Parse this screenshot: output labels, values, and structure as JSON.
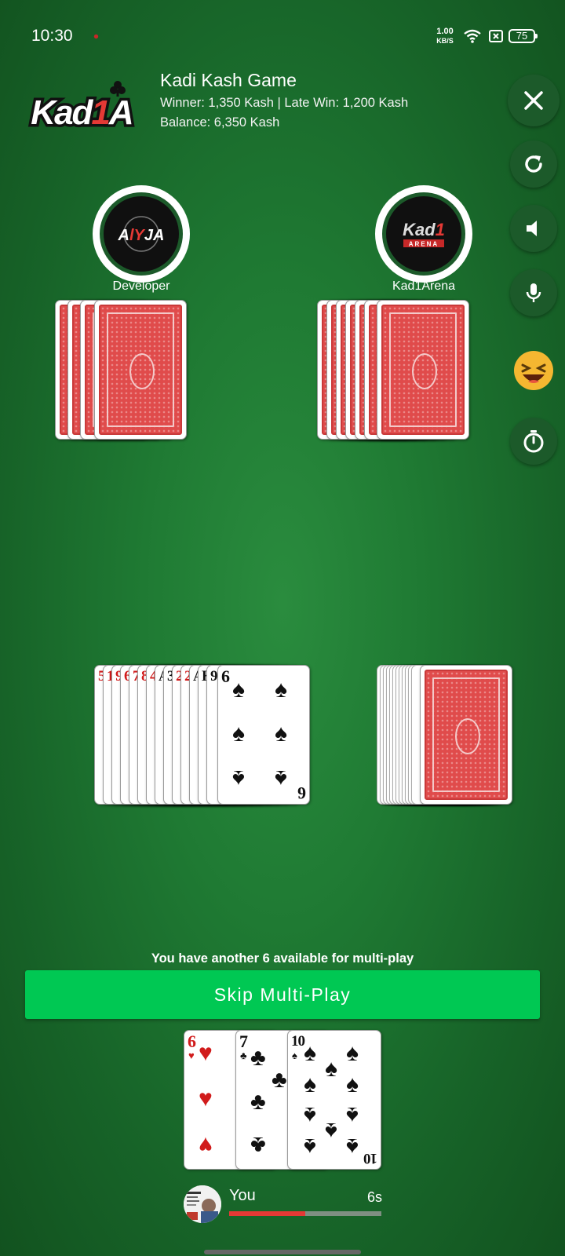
{
  "status_bar": {
    "time": "10:30",
    "net_speed_value": "1.00",
    "net_speed_unit": "KB/S",
    "battery": "75"
  },
  "header": {
    "logo_text": "Kad1A",
    "title": "Kadi Kash Game",
    "prize_line": "Winner: 1,350 Kash | Late Win: 1,200 Kash",
    "balance_line": "Balance: 6,350 Kash"
  },
  "side_buttons": [
    {
      "name": "close-icon"
    },
    {
      "name": "refresh-icon"
    },
    {
      "name": "speaker-icon"
    },
    {
      "name": "microphone-icon"
    },
    {
      "name": "emoji-icon"
    },
    {
      "name": "stopwatch-icon"
    }
  ],
  "opponents": [
    {
      "name": "Developer",
      "avatar_text": "AlYJA"
    },
    {
      "name": "Kad1Arena",
      "avatar_text": "Kad1",
      "avatar_sub": "ARENA"
    }
  ],
  "discard_pile": {
    "under_ranks": [
      "5",
      "10",
      "9",
      "6",
      "7",
      "8",
      "4",
      "A",
      "3",
      "2",
      "2",
      "A",
      "K",
      "9"
    ],
    "top_card": {
      "rank": "6",
      "suit": "spades"
    }
  },
  "hint": "You have another 6 available for multi-play",
  "skip_button": "Skip Multi-Play",
  "hand": [
    {
      "rank": "6",
      "suit": "hearts"
    },
    {
      "rank": "7",
      "suit": "clubs"
    },
    {
      "rank": "10",
      "suit": "spades"
    }
  ],
  "player": {
    "name": "You",
    "timer": "6s",
    "timer_progress": 0.5
  },
  "colors": {
    "felt": "#1f7a33",
    "accent_green": "#00c853",
    "timer_red": "#e53935",
    "card_back_red": "#e04b4b"
  }
}
